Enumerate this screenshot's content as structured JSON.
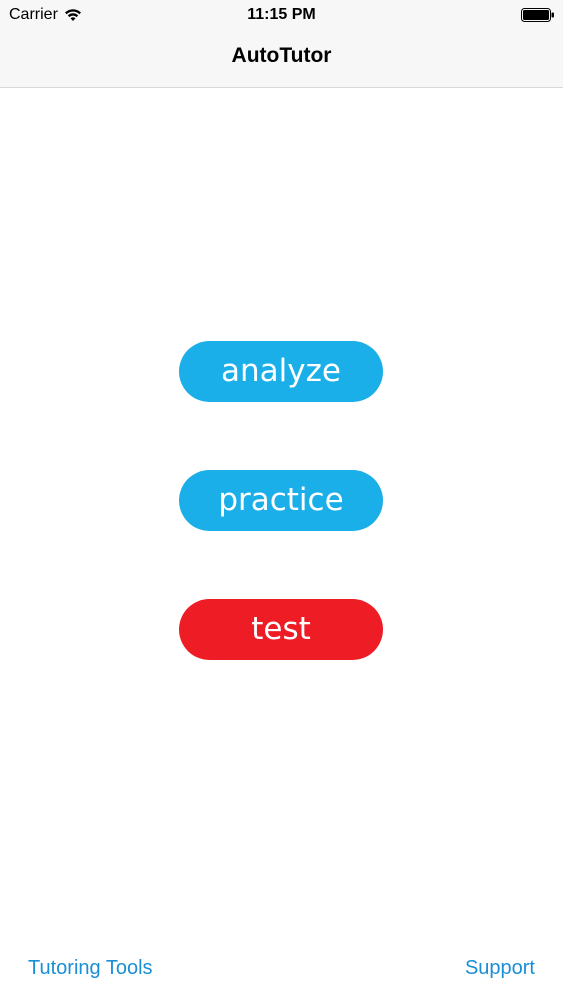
{
  "status_bar": {
    "carrier": "Carrier",
    "time": "11:15 PM",
    "wifi_icon": "wifi-icon",
    "battery_icon": "battery-icon"
  },
  "nav": {
    "title": "AutoTutor"
  },
  "buttons": {
    "analyze": "analyze",
    "practice": "practice",
    "test": "test"
  },
  "bottom": {
    "left_link": "Tutoring Tools",
    "right_link": "Support"
  },
  "colors": {
    "primary_button": "#1aafe8",
    "test_button": "#ee1c25",
    "link": "#1a8fd6"
  }
}
